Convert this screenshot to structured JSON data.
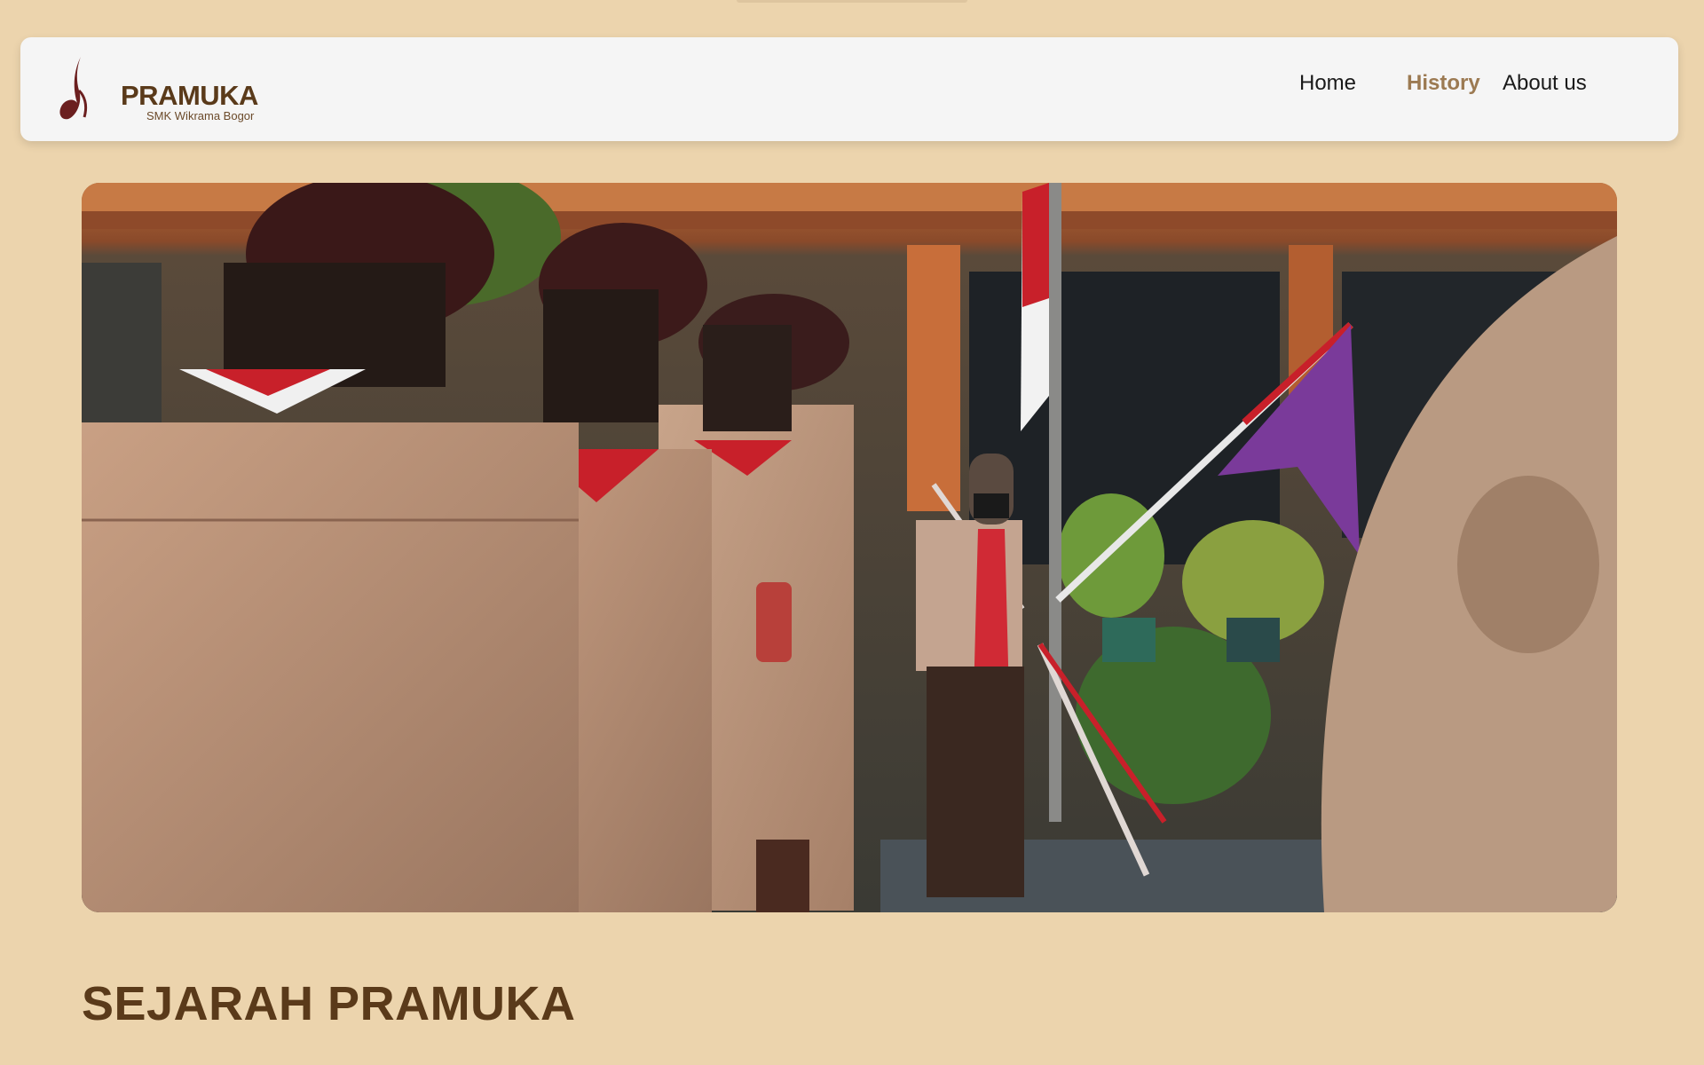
{
  "brand": {
    "name": "PRAMUKA",
    "subtitle": "SMK Wikrama Bogor",
    "logo_icon": "scout-logo-icon"
  },
  "nav": {
    "items": [
      {
        "label": "Home",
        "active": false
      },
      {
        "label": "History",
        "active": true
      },
      {
        "label": "About us",
        "active": false
      }
    ]
  },
  "hero": {
    "image_description_icon": "scouts-ceremony-photo"
  },
  "main": {
    "title": "SEJARAH PRAMUKA"
  },
  "colors": {
    "background": "#ecd4ad",
    "navbar": "#f5f5f5",
    "brand_text": "#5a3a1a",
    "active_link": "#9c7a52"
  }
}
